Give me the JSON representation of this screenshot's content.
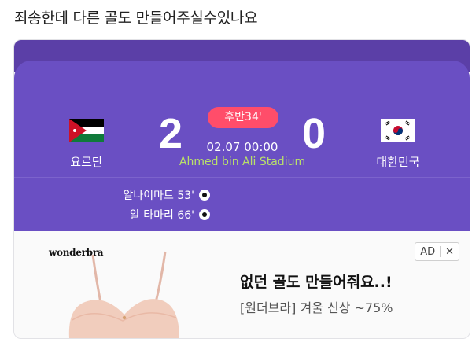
{
  "post": {
    "text": "죄송한데 다른 골도 만들어주실수있나요"
  },
  "match": {
    "home": {
      "name": "요르단",
      "score": "2"
    },
    "away": {
      "name": "대한민국",
      "score": "0"
    },
    "status": "후반34'",
    "datetime": "02.07 00:00",
    "stadium": "Ahmed bin Ali Stadium",
    "scorers": [
      {
        "text": "알나이마트 53'"
      },
      {
        "text": "알 타마리 66'"
      }
    ]
  },
  "ad": {
    "brand": "wonderbra",
    "badge_label": "AD",
    "close_label": "✕",
    "headline": "없던 골도 만들어줘요..!",
    "subtext": "[원더브라] 겨울 신상 ~75%"
  },
  "colors": {
    "panel": "#6a4fc3",
    "badge": "#ff4d6a",
    "stadium_text": "#b9e06a"
  }
}
